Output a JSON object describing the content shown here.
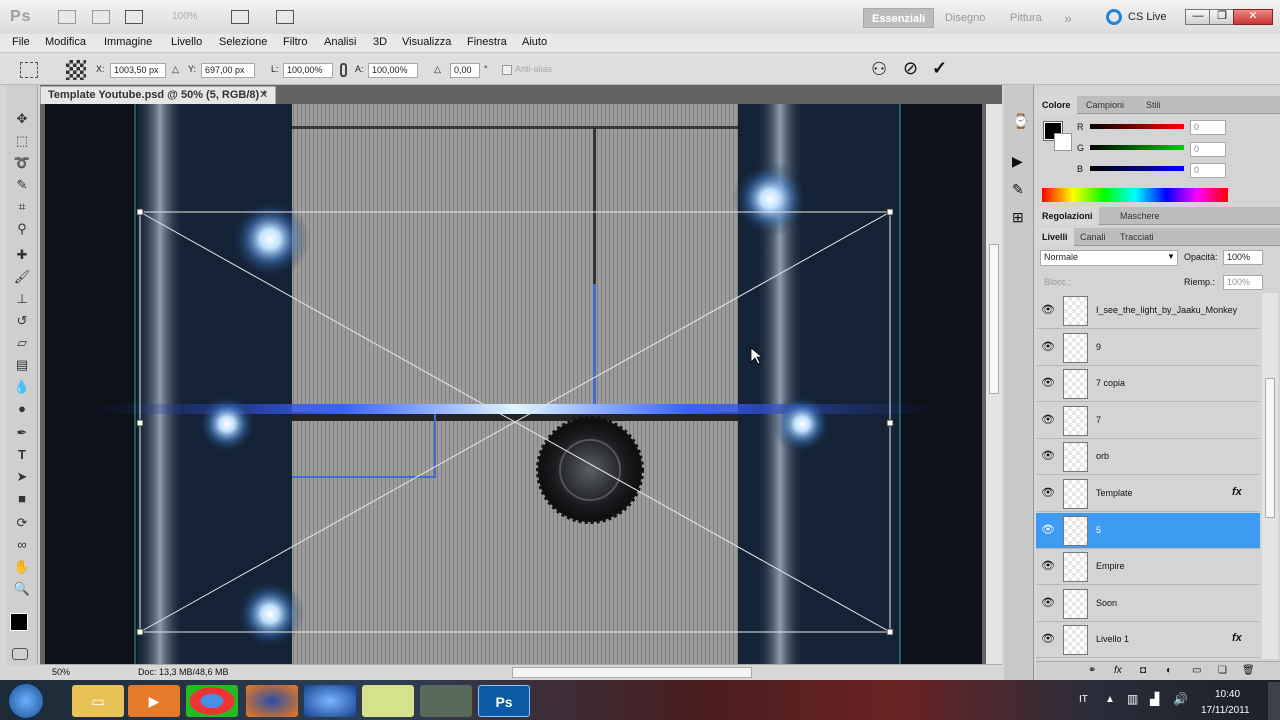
{
  "titlebar": {
    "zoom": "100%",
    "workspaces": [
      "Essenziali",
      "Disegno",
      "Pittura"
    ],
    "more": "»",
    "cslive": "CS Live",
    "win_min": "—",
    "win_max": "❐",
    "win_close": "✕"
  },
  "menu": [
    "File",
    "Modifica",
    "Immagine",
    "Livello",
    "Selezione",
    "Filtro",
    "Analisi",
    "3D",
    "Visualizza",
    "Finestra",
    "Aiuto"
  ],
  "options": {
    "x_label": "X:",
    "x_value": "1003,50 px",
    "y_label": "Y:",
    "y_value": "697,00 px",
    "l_label": "L:",
    "l_value": "100,00%",
    "a_label": "A:",
    "a_value": "100,00%",
    "angle_label": "△",
    "angle_value": "0,00",
    "deg": "°",
    "antialias": "Anti-alias",
    "cancel_icon": "⊘",
    "commit_icon": "✓",
    "warp_icon": "⚇"
  },
  "document": {
    "tab_title": "Template Youtube.psd @ 50% (5, RGB/8) *",
    "tab_close": "✕",
    "zoom_status": "50%",
    "doc_size": "Doc: 13,3 MB/48,6 MB"
  },
  "color_panel": {
    "tabs": [
      "Colore",
      "Campioni",
      "Stili"
    ],
    "r_label": "R",
    "g_label": "G",
    "b_label": "B",
    "r": "0",
    "g": "0",
    "b": "0"
  },
  "adjust_panel": {
    "tabs": [
      "Regolazioni",
      "Maschere"
    ]
  },
  "layers_panel": {
    "tabs": [
      "Livelli",
      "Canali",
      "Tracciati"
    ],
    "blend_mode": "Normale",
    "opacity_label": "Opacità:",
    "opacity": "100%",
    "lock_label": "Blocc.:",
    "fill_label": "Riemp.:",
    "fill": "100%",
    "layers": [
      {
        "name": "I_see_the_light_by_Jaaku_Monkey",
        "fx": ""
      },
      {
        "name": "9",
        "fx": ""
      },
      {
        "name": "7 copia",
        "fx": ""
      },
      {
        "name": "7",
        "fx": ""
      },
      {
        "name": "orb",
        "fx": ""
      },
      {
        "name": "Template",
        "fx": "fx"
      },
      {
        "name": "5",
        "fx": ""
      },
      {
        "name": "Empire",
        "fx": ""
      },
      {
        "name": "Soon",
        "fx": ""
      },
      {
        "name": "Livello 1",
        "fx": "fx"
      }
    ],
    "selected_index": 6
  },
  "taskbar": {
    "lang": "IT",
    "time": "10:40",
    "date": "17/11/2011",
    "apps": [
      "Explorer",
      "Media",
      "Chrome",
      "Firefox",
      "Globe",
      "Notes",
      "Tool",
      "Ps"
    ]
  },
  "colors": {
    "selection": "#3d9bf2",
    "accent_blue": "#4ea6ff"
  }
}
